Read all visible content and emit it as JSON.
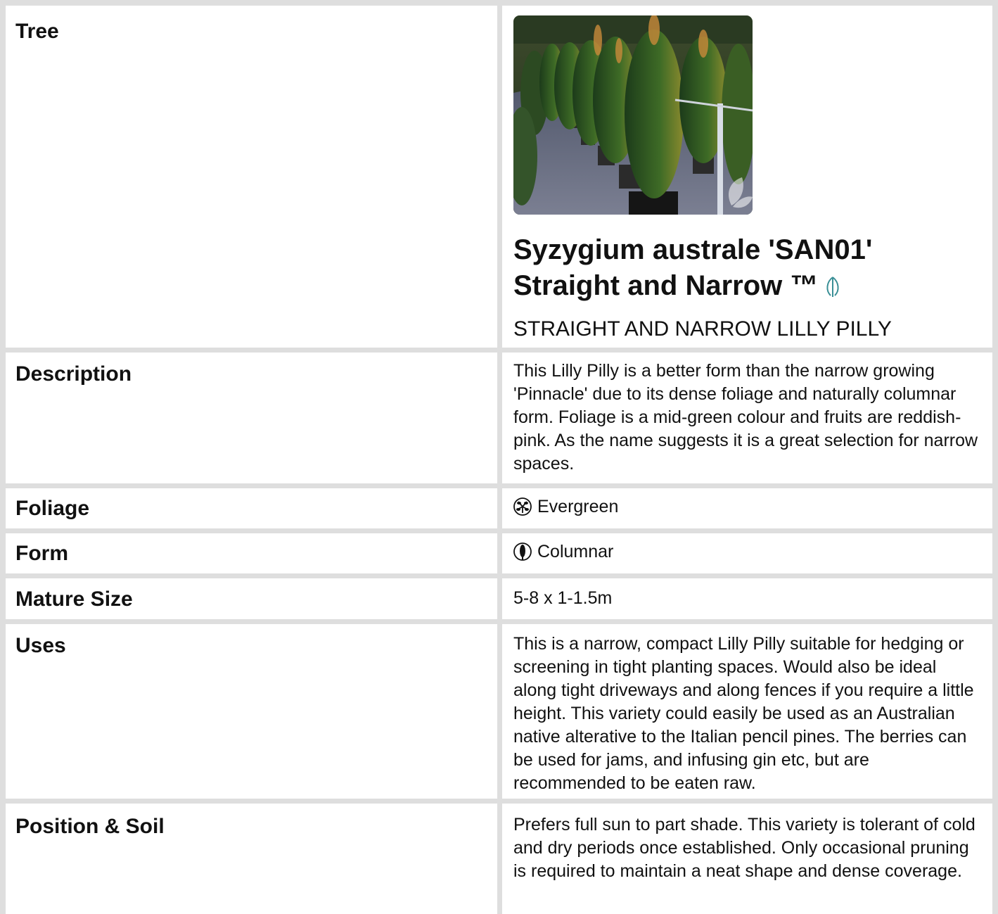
{
  "rows": {
    "tree": {
      "label": "Tree",
      "title": "Syzygium australe 'SAN01' Straight and Narrow ™",
      "title_icon": "native-leaf-icon",
      "common_name": "STRAIGHT AND NARROW LILLY PILLY"
    },
    "description": {
      "label": "Description",
      "value": "This Lilly Pilly is a better form than the narrow growing 'Pinnacle' due to its dense foliage and naturally columnar form. Foliage is a mid-green colour and fruits are reddish-pink. As the name suggests it is a great selection for narrow spaces."
    },
    "foliage": {
      "label": "Foliage",
      "icon": "evergreen-icon",
      "value": "Evergreen"
    },
    "form": {
      "label": "Form",
      "icon": "columnar-form-icon",
      "value": "Columnar"
    },
    "mature_size": {
      "label": "Mature Size",
      "value": "5-8 x 1-1.5m"
    },
    "uses": {
      "label": "Uses",
      "value": "This is a narrow, compact Lilly Pilly suitable for hedging or screening in tight planting spaces. Would also be ideal along tight driveways and along fences if you require a little height. This variety could easily be used as an Australian native alterative to the Italian pencil pines. The berries can be used for jams, and infusing gin etc, but are recommended to be eaten raw."
    },
    "position_soil": {
      "label": "Position & Soil",
      "value": "Prefers full sun to part shade. This variety is tolerant of cold and dry periods once established. Only occasional pruning is required to maintain a neat shape and dense coverage."
    }
  },
  "colors": {
    "border": "#dedede",
    "icon_teal": "#3a8f96",
    "text": "#111111"
  }
}
